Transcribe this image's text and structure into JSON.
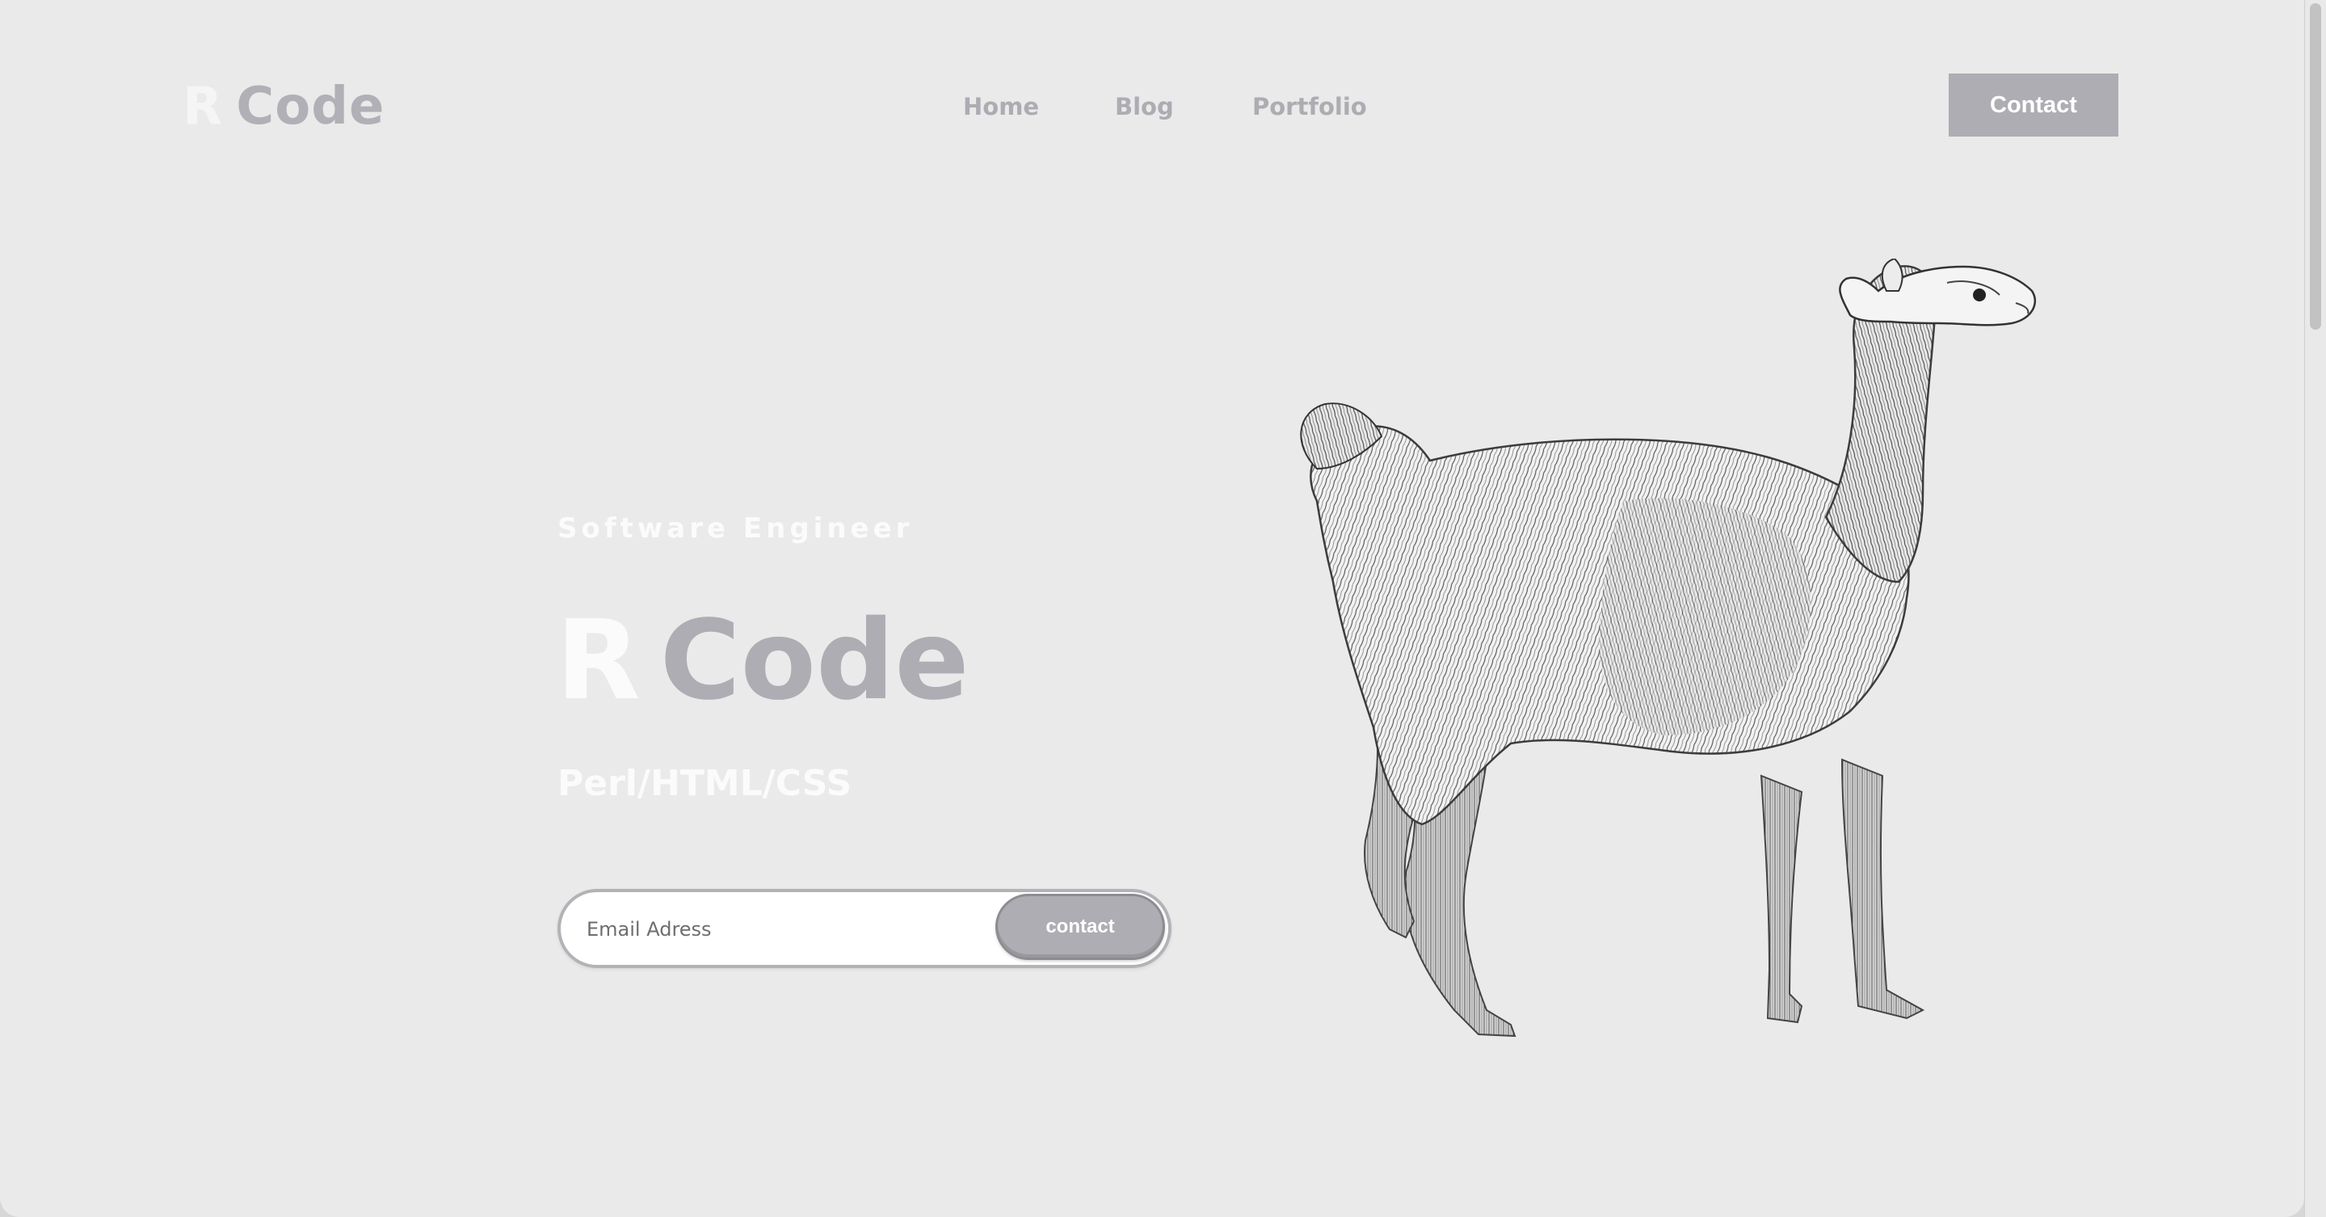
{
  "header": {
    "logo_first": "R",
    "logo_second": "Code",
    "nav": [
      {
        "label": "Home"
      },
      {
        "label": "Blog"
      },
      {
        "label": "Portfolio"
      }
    ],
    "contact_label": "Contact"
  },
  "hero": {
    "subtitle": "Software Engineer",
    "title_first": "R",
    "title_second": "Code",
    "skills": "Perl/HTML/CSS",
    "email_placeholder": "Email Adress",
    "submit_label": "contact"
  },
  "illustration": {
    "icon": "llama-illustration"
  },
  "colors": {
    "background": "#eaeaea",
    "accent": "#aeadb3",
    "white_text": "#fbfbfb"
  }
}
